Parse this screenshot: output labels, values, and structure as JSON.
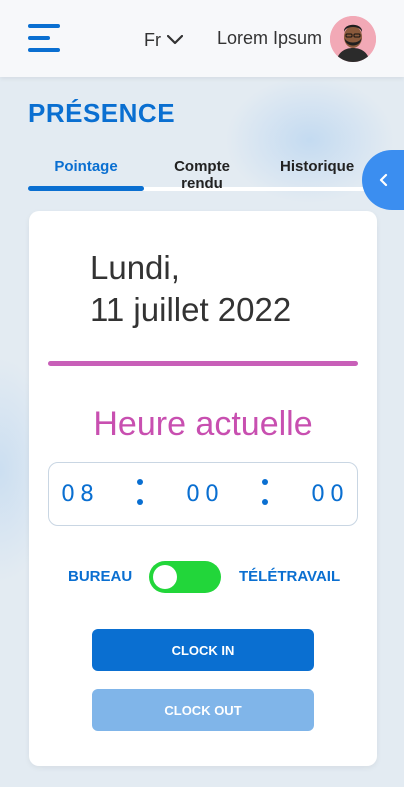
{
  "header": {
    "language": "Fr",
    "username": "Lorem Ipsum"
  },
  "page": {
    "title": "PRÉSENCE"
  },
  "tabs": [
    {
      "label": "Pointage",
      "active": true
    },
    {
      "label": "Compte rendu",
      "active": false
    },
    {
      "label": "Historique",
      "active": false
    }
  ],
  "card": {
    "day": "Lundi,",
    "date": "11 juillet 2022",
    "clock_label": "Heure actuelle",
    "time": {
      "hours": "08",
      "minutes": "00",
      "seconds": "00"
    },
    "mode_left": "BUREAU",
    "mode_right": "TÉLÉTRAVAIL",
    "clock_in_label": "CLOCK IN",
    "clock_out_label": "CLOCK OUT"
  },
  "icons": {
    "menu": "hamburger-menu-icon",
    "language_dropdown": "chevron-down-icon",
    "collapse": "chevron-left-icon"
  },
  "colors": {
    "primary": "#0a6fd1",
    "accent": "#c84fb0",
    "toggle_on": "#22d63a",
    "button_disabled": "#80b5e9"
  }
}
